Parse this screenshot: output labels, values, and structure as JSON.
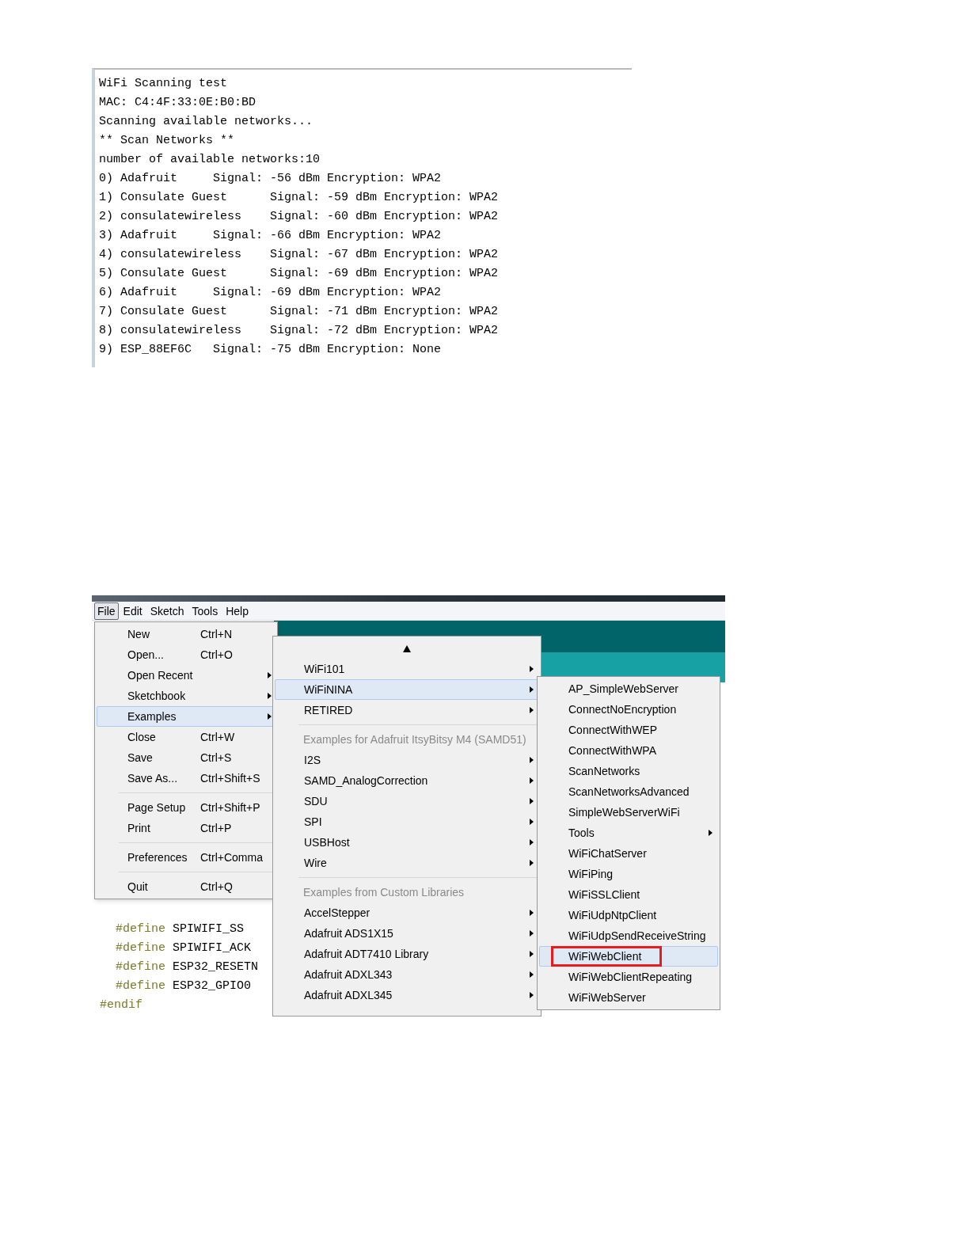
{
  "serial_monitor": {
    "lines": [
      "WiFi Scanning test",
      "MAC: C4:4F:33:0E:B0:BD",
      "Scanning available networks...",
      "** Scan Networks **",
      "number of available networks:10",
      "0) Adafruit     Signal: -56 dBm Encryption: WPA2",
      "1) Consulate Guest      Signal: -59 dBm Encryption: WPA2",
      "2) consulatewireless    Signal: -60 dBm Encryption: WPA2",
      "3) Adafruit     Signal: -66 dBm Encryption: WPA2",
      "4) consulatewireless    Signal: -67 dBm Encryption: WPA2",
      "5) Consulate Guest      Signal: -69 dBm Encryption: WPA2",
      "6) Adafruit     Signal: -69 dBm Encryption: WPA2",
      "7) Consulate Guest      Signal: -71 dBm Encryption: WPA2",
      "8) consulatewireless    Signal: -72 dBm Encryption: WPA2",
      "9) ESP_88EF6C   Signal: -75 dBm Encryption: None"
    ]
  },
  "ide": {
    "menubar": [
      {
        "label": "File",
        "selected": true
      },
      {
        "label": "Edit",
        "selected": false
      },
      {
        "label": "Sketch",
        "selected": false
      },
      {
        "label": "Tools",
        "selected": false
      },
      {
        "label": "Help",
        "selected": false
      }
    ],
    "code_lines": [
      {
        "directive": "#define",
        "args": "SPIWIFI_SS"
      },
      {
        "directive": "#define",
        "args": "SPIWIFI_ACK"
      },
      {
        "directive": "#define",
        "args": "ESP32_RESETN"
      },
      {
        "directive": "#define",
        "args": "ESP32_GPIO0"
      },
      {
        "directive": "#endif"
      }
    ],
    "file_menu": [
      {
        "kind": "item",
        "label": "New",
        "shortcut": "Ctrl+N",
        "submenu": false,
        "selected": false
      },
      {
        "kind": "item",
        "label": "Open...",
        "shortcut": "Ctrl+O",
        "submenu": false,
        "selected": false
      },
      {
        "kind": "item",
        "label": "Open Recent",
        "submenu": true,
        "selected": false
      },
      {
        "kind": "item",
        "label": "Sketchbook",
        "submenu": true,
        "selected": false
      },
      {
        "kind": "item",
        "label": "Examples",
        "submenu": true,
        "selected": true
      },
      {
        "kind": "item",
        "label": "Close",
        "shortcut": "Ctrl+W",
        "submenu": false,
        "selected": false
      },
      {
        "kind": "item",
        "label": "Save",
        "shortcut": "Ctrl+S",
        "submenu": false,
        "selected": false
      },
      {
        "kind": "item",
        "label": "Save As...",
        "shortcut": "Ctrl+Shift+S",
        "submenu": false,
        "selected": false
      },
      {
        "kind": "separator"
      },
      {
        "kind": "item",
        "label": "Page Setup",
        "shortcut": "Ctrl+Shift+P",
        "submenu": false,
        "selected": false
      },
      {
        "kind": "item",
        "label": "Print",
        "shortcut": "Ctrl+P",
        "submenu": false,
        "selected": false
      },
      {
        "kind": "separator"
      },
      {
        "kind": "item",
        "label": "Preferences",
        "shortcut": "Ctrl+Comma",
        "submenu": false,
        "selected": false
      },
      {
        "kind": "separator"
      },
      {
        "kind": "item",
        "label": "Quit",
        "shortcut": "Ctrl+Q",
        "submenu": false,
        "selected": false
      }
    ],
    "examples_menu": [
      {
        "kind": "scroll_up"
      },
      {
        "kind": "item",
        "label": "WiFi101",
        "submenu": true,
        "selected": false
      },
      {
        "kind": "item",
        "label": "WiFiNINA",
        "submenu": true,
        "selected": true
      },
      {
        "kind": "item",
        "label": "RETIRED",
        "submenu": true,
        "selected": false
      },
      {
        "kind": "separator"
      },
      {
        "kind": "header",
        "label": "Examples for Adafruit ItsyBitsy M4 (SAMD51)"
      },
      {
        "kind": "item",
        "label": "I2S",
        "submenu": true,
        "selected": false
      },
      {
        "kind": "item",
        "label": "SAMD_AnalogCorrection",
        "submenu": true,
        "selected": false
      },
      {
        "kind": "item",
        "label": "SDU",
        "submenu": true,
        "selected": false
      },
      {
        "kind": "item",
        "label": "SPI",
        "submenu": true,
        "selected": false
      },
      {
        "kind": "item",
        "label": "USBHost",
        "submenu": true,
        "selected": false
      },
      {
        "kind": "item",
        "label": "Wire",
        "submenu": true,
        "selected": false
      },
      {
        "kind": "separator"
      },
      {
        "kind": "header",
        "label": "Examples from Custom Libraries"
      },
      {
        "kind": "item",
        "label": "AccelStepper",
        "submenu": true,
        "selected": false
      },
      {
        "kind": "item",
        "label": "Adafruit ADS1X15",
        "submenu": true,
        "selected": false
      },
      {
        "kind": "item",
        "label": "Adafruit ADT7410 Library",
        "submenu": true,
        "selected": false
      },
      {
        "kind": "item",
        "label": "Adafruit ADXL343",
        "submenu": true,
        "selected": false
      },
      {
        "kind": "item",
        "label": "Adafruit ADXL345",
        "submenu": true,
        "selected": false
      }
    ],
    "wifinina_menu": [
      {
        "label": "AP_SimpleWebServer",
        "submenu": false,
        "selected": false,
        "marked": false
      },
      {
        "label": "ConnectNoEncryption",
        "submenu": false,
        "selected": false,
        "marked": false
      },
      {
        "label": "ConnectWithWEP",
        "submenu": false,
        "selected": false,
        "marked": false
      },
      {
        "label": "ConnectWithWPA",
        "submenu": false,
        "selected": false,
        "marked": false
      },
      {
        "label": "ScanNetworks",
        "submenu": false,
        "selected": false,
        "marked": false
      },
      {
        "label": "ScanNetworksAdvanced",
        "submenu": false,
        "selected": false,
        "marked": false
      },
      {
        "label": "SimpleWebServerWiFi",
        "submenu": false,
        "selected": false,
        "marked": false
      },
      {
        "label": "Tools",
        "submenu": true,
        "selected": false,
        "marked": false
      },
      {
        "label": "WiFiChatServer",
        "submenu": false,
        "selected": false,
        "marked": false
      },
      {
        "label": "WiFiPing",
        "submenu": false,
        "selected": false,
        "marked": false
      },
      {
        "label": "WiFiSSLClient",
        "submenu": false,
        "selected": false,
        "marked": false
      },
      {
        "label": "WiFiUdpNtpClient",
        "submenu": false,
        "selected": false,
        "marked": false
      },
      {
        "label": "WiFiUdpSendReceiveString",
        "submenu": false,
        "selected": false,
        "marked": false
      },
      {
        "label": "WiFiWebClient",
        "submenu": false,
        "selected": true,
        "marked": true
      },
      {
        "label": "WiFiWebClientRepeating",
        "submenu": false,
        "selected": false,
        "marked": false
      },
      {
        "label": "WiFiWebServer",
        "submenu": false,
        "selected": false,
        "marked": false
      }
    ]
  }
}
